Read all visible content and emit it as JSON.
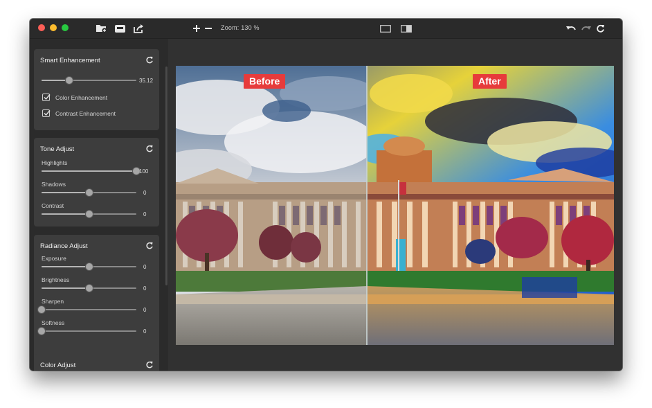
{
  "toolbar": {
    "zoom_label": "Zoom: 130 %",
    "icons": [
      "add-folder-icon",
      "import-icon",
      "share-icon",
      "zoom-in-icon",
      "zoom-out-icon",
      "single-view-icon",
      "split-view-icon",
      "undo-icon",
      "redo-icon",
      "refresh-icon"
    ]
  },
  "sidebar": {
    "smart": {
      "title": "Smart Enhancement",
      "slider_value": "35.12",
      "slider_fraction": 0.29,
      "color_enhancement": "Color Enhancement",
      "contrast_enhancement": "Contrast Enhancement"
    },
    "tone": {
      "title": "Tone Adjust",
      "highlights": {
        "label": "Highlights",
        "value": "100",
        "fraction": 1.0
      },
      "shadows": {
        "label": "Shadows",
        "value": "0",
        "fraction": 0.5
      },
      "contrast": {
        "label": "Contrast",
        "value": "0",
        "fraction": 0.5
      }
    },
    "radiance": {
      "title": "Radiance Adjust",
      "exposure": {
        "label": "Exposure",
        "value": "0",
        "fraction": 0.5
      },
      "brightness": {
        "label": "Brightness",
        "value": "0",
        "fraction": 0.5
      },
      "sharpen": {
        "label": "Sharpen",
        "value": "0",
        "fraction": 0.0
      },
      "softness": {
        "label": "Softness",
        "value": "0",
        "fraction": 0.0
      }
    },
    "color": {
      "title": "Color Adjust"
    }
  },
  "preview": {
    "before_label": "Before",
    "after_label": "After",
    "divider_fraction": 0.435
  },
  "colors": {
    "accent_label": "#e73b3b",
    "panel": "#3d3d3d",
    "window": "#2b2b2b"
  }
}
